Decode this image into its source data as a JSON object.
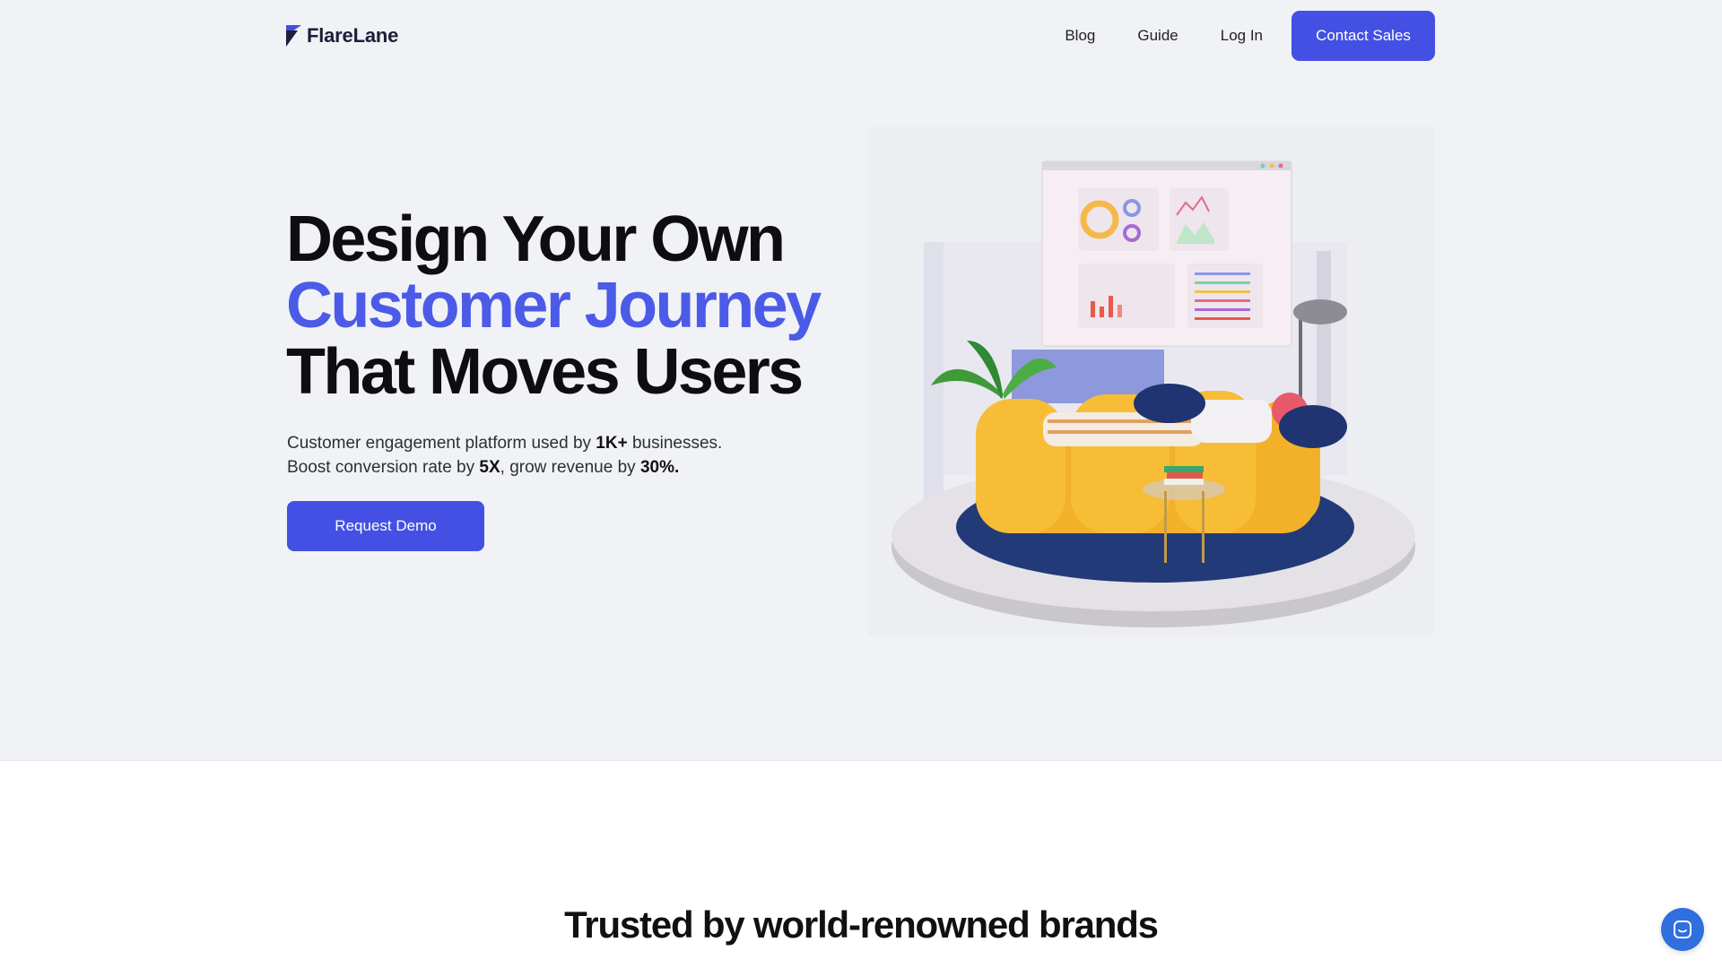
{
  "brand": {
    "name": "FlareLane",
    "color": "#4450e3"
  },
  "nav": {
    "links": [
      "Blog",
      "Guide",
      "Log In"
    ],
    "cta_label": "Contact Sales"
  },
  "hero": {
    "headline_line1": "Design Your Own",
    "headline_line2": "Customer Journey",
    "headline_line3": "That Moves Users",
    "accent_color": "#4b5be8",
    "sub_line1_a": "Customer engagement platform used by ",
    "sub_line1_b": "1K+",
    "sub_line1_c": " businesses.",
    "sub_line2_a": "Boost conversion rate by ",
    "sub_line2_b": "5X",
    "sub_line2_c": ", grow revenue by ",
    "sub_line2_d": "30%.",
    "cta_label": "Request Demo"
  },
  "trusted": {
    "title": "Trusted by world-renowned brands"
  },
  "widgets": {
    "chat_icon": "chat-icon"
  }
}
